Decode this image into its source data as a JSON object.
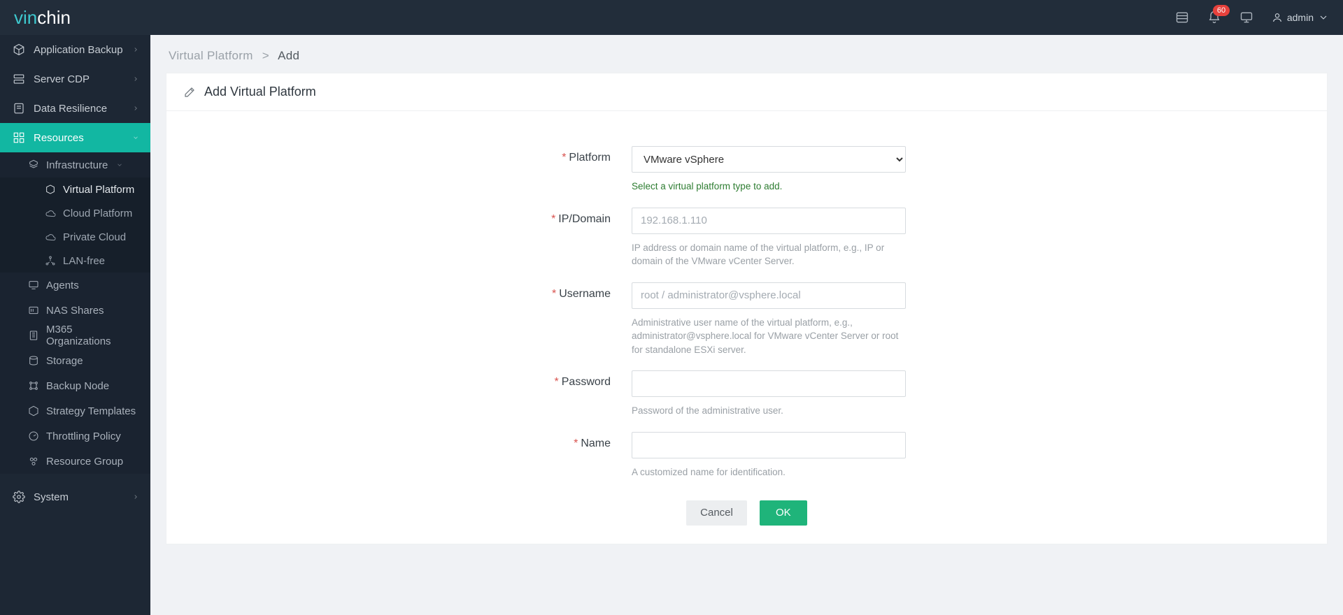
{
  "brand": {
    "part1": "vin",
    "part2": "chin"
  },
  "topbar": {
    "notification_count": "60",
    "username": "admin"
  },
  "sidebar": {
    "app_backup": "Application Backup",
    "server_cdp": "Server CDP",
    "data_resilience": "Data Resilience",
    "resources": "Resources",
    "infrastructure": "Infrastructure",
    "virtual_platform": "Virtual Platform",
    "cloud_platform": "Cloud Platform",
    "private_cloud": "Private Cloud",
    "lan_free": "LAN-free",
    "agents": "Agents",
    "nas_shares": "NAS Shares",
    "m365": "M365 Organizations",
    "storage": "Storage",
    "backup_node": "Backup Node",
    "strategy_templates": "Strategy Templates",
    "throttling_policy": "Throttling Policy",
    "resource_group": "Resource Group",
    "system": "System"
  },
  "crumbs": {
    "parent": "Virtual Platform",
    "sep": ">",
    "current": "Add"
  },
  "panel": {
    "title": "Add Virtual Platform"
  },
  "form": {
    "platform": {
      "label": "Platform",
      "value": "VMware vSphere",
      "help": "Select a virtual platform type to add."
    },
    "ip": {
      "label": "IP/Domain",
      "placeholder": "192.168.1.110",
      "help": "IP address or domain name of the virtual platform, e.g., IP or domain of the VMware vCenter Server."
    },
    "username": {
      "label": "Username",
      "placeholder": "root / administrator@vsphere.local",
      "help": "Administrative user name of the virtual platform, e.g., administrator@vsphere.local for VMware vCenter Server or root for standalone ESXi server."
    },
    "password": {
      "label": "Password",
      "help": "Password of the administrative user."
    },
    "name": {
      "label": "Name",
      "help": "A customized name for identification."
    },
    "buttons": {
      "cancel": "Cancel",
      "ok": "OK"
    },
    "required_mark": "*"
  }
}
